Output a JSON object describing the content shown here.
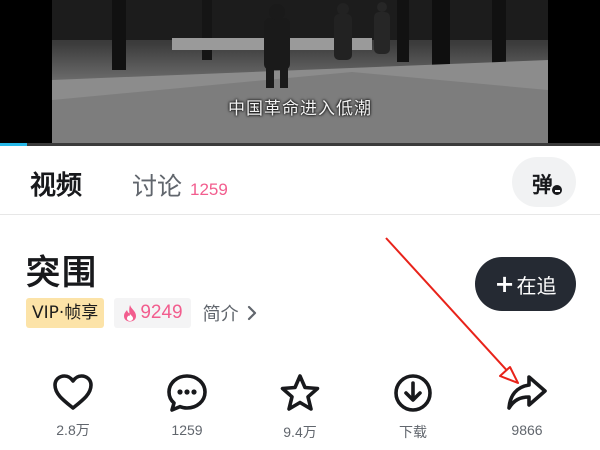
{
  "player": {
    "subtitle": "中国革命进入低潮",
    "progress": 0.045
  },
  "tabs": {
    "video_label": "视频",
    "discuss_label": "讨论",
    "discuss_count": "1259",
    "danmaku_label": "弹"
  },
  "show": {
    "title": "突围",
    "follow_label": "在追",
    "vip_tag": "VIP·帧享",
    "heat_value": "9249",
    "intro_label": "简介"
  },
  "actions": [
    {
      "icon": "heart-icon",
      "label": "2.8万"
    },
    {
      "icon": "comment-icon",
      "label": "1259"
    },
    {
      "icon": "star-icon",
      "label": "9.4万"
    },
    {
      "icon": "download-icon",
      "label": "下载"
    },
    {
      "icon": "share-icon",
      "label": "9866"
    }
  ],
  "colors": {
    "accent_pink": "#f25d8e",
    "progress_blue": "#26b8e8",
    "vip_bg": "#fce3a8",
    "follow_bg": "#252a33",
    "annotation_red": "#e8231a"
  }
}
